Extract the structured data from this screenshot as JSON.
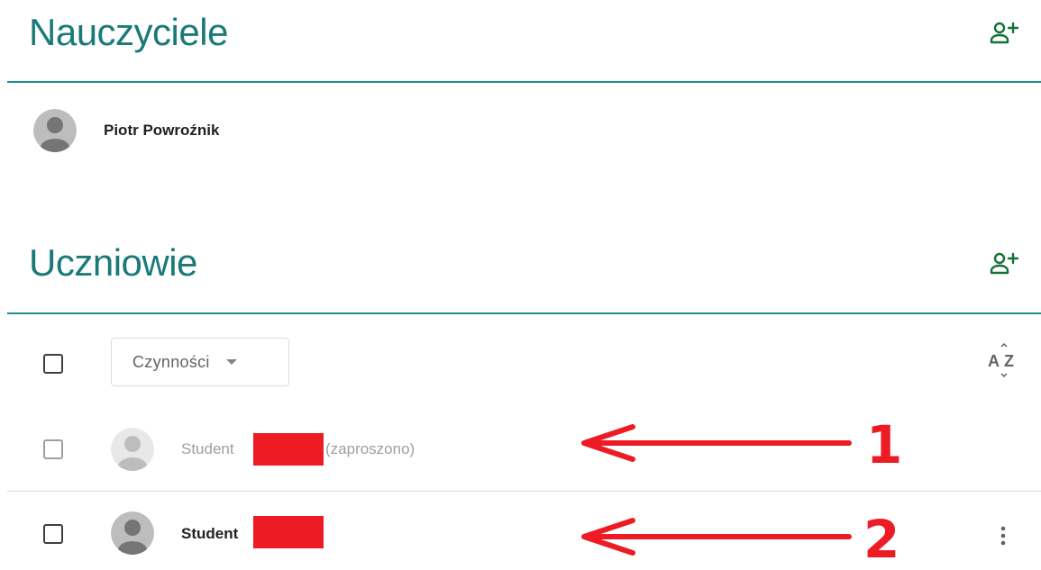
{
  "teachers": {
    "title": "Nauczyciele",
    "add_icon": "person-add-icon",
    "members": [
      {
        "name": "Piotr Powroźnik"
      }
    ]
  },
  "students": {
    "title": "Uczniowie",
    "add_icon": "person-add-icon",
    "actions_label": "Czynności",
    "sort_icon": "sort-az-icon",
    "sort_top": "A",
    "sort_bottom": "Z",
    "rows": [
      {
        "name": "Student",
        "status": "(zaproszono)",
        "menu": false
      },
      {
        "name": "Student",
        "status": "",
        "menu": true,
        "menu_icon": "more-vert-icon"
      }
    ]
  },
  "annotations": [
    {
      "label": "1",
      "color": "#ed1c24"
    },
    {
      "label": "2",
      "color": "#ed1c24"
    }
  ],
  "colors": {
    "accent": "#137333",
    "title": "#1a7a7a",
    "divider": "#1e8e8e",
    "annotation": "#ed1c24"
  }
}
